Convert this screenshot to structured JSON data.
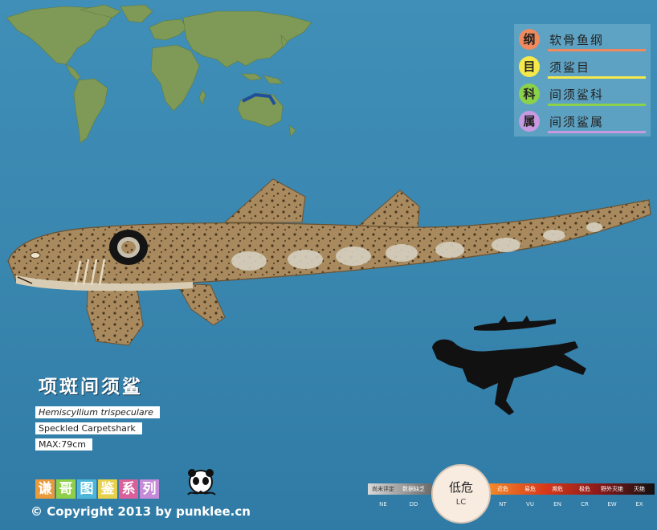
{
  "taxonomy": [
    {
      "rank": "纲",
      "name": "软骨鱼纲",
      "color": "#f08a5d"
    },
    {
      "rank": "目",
      "name": "须鲨目",
      "color": "#f5e94a"
    },
    {
      "rank": "科",
      "name": "间须鲨科",
      "color": "#8bd14a"
    },
    {
      "rank": "属",
      "name": "间须鲨属",
      "color": "#c79ae0"
    }
  ],
  "species": {
    "chinese_name": "项斑间须鲨",
    "scientific_name": "Hemiscyllium trispeculare",
    "english_name": "Speckled Carpetshark",
    "max_size": "MAX:79cm"
  },
  "series": {
    "chars": [
      "谦",
      "哥",
      "图",
      "鉴",
      "系",
      "列"
    ],
    "colors": [
      "#e99a3a",
      "#8fcf4a",
      "#4db6d8",
      "#e8d04a",
      "#d9609a",
      "#c58ad8"
    ]
  },
  "copyright": "© Copyright 2013 by punklee.cn",
  "conservation": {
    "current_label": "低危",
    "current_code": "LC",
    "left": [
      {
        "label": "尚未评定",
        "code": "NE"
      },
      {
        "label": "数据缺乏",
        "code": "DD"
      }
    ],
    "right": [
      {
        "label": "近危",
        "code": "NT"
      },
      {
        "label": "易危",
        "code": "VU"
      },
      {
        "label": "濒危",
        "code": "EN"
      },
      {
        "label": "极危",
        "code": "CR"
      },
      {
        "label": "野外灭绝",
        "code": "EW"
      },
      {
        "label": "灭绝",
        "code": "EX"
      }
    ]
  }
}
